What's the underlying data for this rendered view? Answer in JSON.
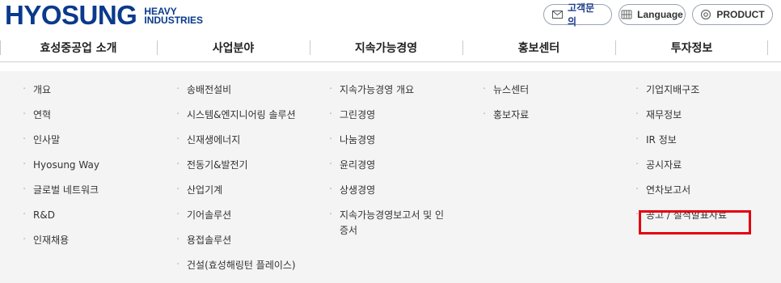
{
  "brand": {
    "main": "HYOSUNG",
    "sub_line1": "HEAVY",
    "sub_line2": "INDUSTRIES",
    "color": "#0a3a8c"
  },
  "utility": {
    "contact": {
      "label": "고객문의",
      "icon": "mail-icon"
    },
    "language": {
      "label": "Language",
      "icon": "globe-icon"
    },
    "product": {
      "label": "PRODUCT",
      "icon": "gear-icon"
    }
  },
  "gnb": [
    {
      "label": "효성중공업 소개"
    },
    {
      "label": "사업분야"
    },
    {
      "label": "지속가능경영"
    },
    {
      "label": "홍보센터"
    },
    {
      "label": "투자정보"
    }
  ],
  "mega": {
    "col1": [
      "개요",
      "연혁",
      "인사말",
      "Hyosung Way",
      "글로벌 네트워크",
      "R&D",
      "인재채용"
    ],
    "col2": [
      "송배전설비",
      "시스템&엔지니어링 솔루션",
      "신재생에너지",
      "전동기&발전기",
      "산업기계",
      "기어솔루션",
      "용접솔루션",
      "건설(효성해링턴 플레이스)"
    ],
    "col3": [
      "지속가능경영 개요",
      "그린경영",
      "나눔경영",
      "윤리경영",
      "상생경영",
      "지속가능경영보고서 및 인증서"
    ],
    "col4": [
      "뉴스센터",
      "홍보자료"
    ],
    "col5": [
      "기업지배구조",
      "재무정보",
      "IR 정보",
      "공시자료",
      "연차보고서",
      "공고 / 실적발표자료"
    ]
  },
  "colors": {
    "highlight_border": "#e3000f",
    "menu_bg": "#f4f4f4"
  }
}
